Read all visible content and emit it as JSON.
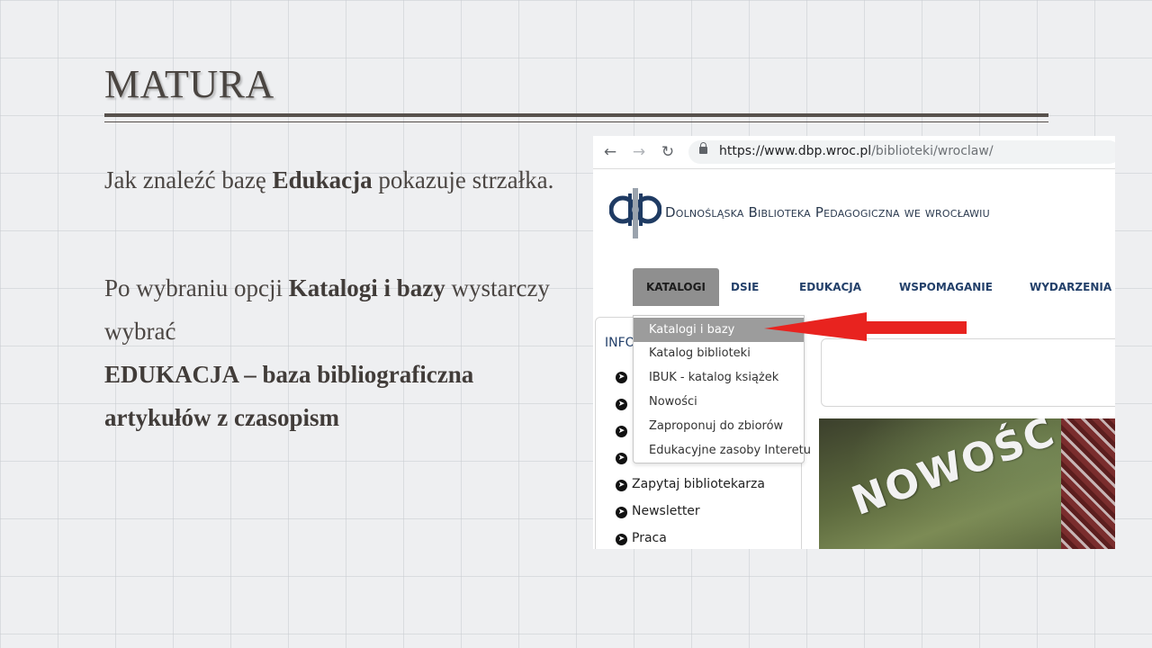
{
  "slide": {
    "title": "MATURA",
    "p1": {
      "t1": "Jak znaleźć bazę ",
      "b1": "Edukacja",
      "t2": " pokazuje strzałka."
    },
    "p2": {
      "t1": "Po wybraniu opcji ",
      "b1": "Katalogi i bazy",
      "t2": " wystarczy wybrać",
      "b2": "EDUKACJA – baza bibliograficzna artykułów z czasopism"
    }
  },
  "browser": {
    "url_main": "https://www.dbp.wroc.pl",
    "url_path": "/biblioteki/wroclaw/",
    "back_icon": "arrow-left-icon",
    "forward_icon": "arrow-right-icon",
    "reload_icon": "reload-icon"
  },
  "site": {
    "library_name": "Dolnośląska Biblioteka Pedagogiczna we wrocławiu",
    "nav": [
      "KATALOGI",
      "DSIE",
      "EDUKACJA",
      "WSPOMAGANIE",
      "WYDARZENIA"
    ],
    "sidebar_header": "INFO",
    "sidebar_items": [
      "Zapytaj bibliotekarza",
      "Newsletter",
      "Praca"
    ],
    "dropdown": [
      "Katalogi i bazy",
      "Katalog biblioteki",
      "IBUK - katalog książek",
      "Nowości",
      "Zaproponuj do zbiorów",
      "Edukacyjne zasoby Interetu"
    ],
    "banner_text": "NOWOŚĆ",
    "arrow_color": "#e8231f"
  }
}
